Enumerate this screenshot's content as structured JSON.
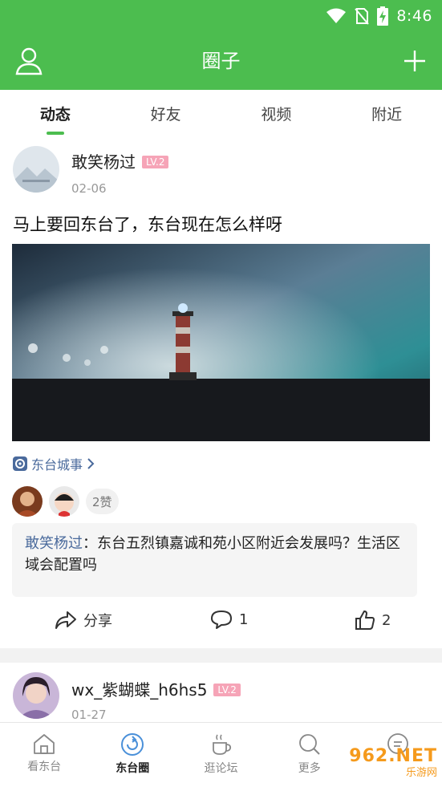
{
  "status_bar": {
    "time": "8:46"
  },
  "header": {
    "title": "圈子",
    "profile_icon": "person-icon",
    "add_icon": "plus-icon"
  },
  "tabs": [
    {
      "label": "动态",
      "active": true
    },
    {
      "label": "好友",
      "active": false
    },
    {
      "label": "视频",
      "active": false
    },
    {
      "label": "附近",
      "active": false
    }
  ],
  "posts": [
    {
      "username": "敢笑杨过",
      "level": "LV.2",
      "date": "02-06",
      "text": "马上要回东台了，东台现在怎么样呀",
      "topic": "东台城事",
      "like_count": "2赞",
      "comment": {
        "author": "敢笑杨过",
        "text": "：东台五烈镇嘉诚和苑小区附近会发展吗？生活区域会配置吗"
      },
      "actions": {
        "share": "分享",
        "comments": "1",
        "likes": "2"
      }
    },
    {
      "username": "wx_紫蝴蝶_h6hs5",
      "level": "LV.2",
      "date": "01-27"
    }
  ],
  "bottom_nav": [
    {
      "label": "看东台",
      "icon": "home-icon",
      "active": false
    },
    {
      "label": "东台圈",
      "icon": "circle-refresh-icon",
      "active": true
    },
    {
      "label": "逛论坛",
      "icon": "coffee-cup-icon",
      "active": false
    },
    {
      "label": "更多",
      "icon": "search-icon",
      "active": false
    }
  ],
  "watermark": {
    "brand": "962.NET",
    "sub": "乐游网"
  },
  "colors": {
    "brand_green": "#4cbd4f",
    "link_blue": "#4a6a9c",
    "level_pink": "#f6a4b7"
  }
}
